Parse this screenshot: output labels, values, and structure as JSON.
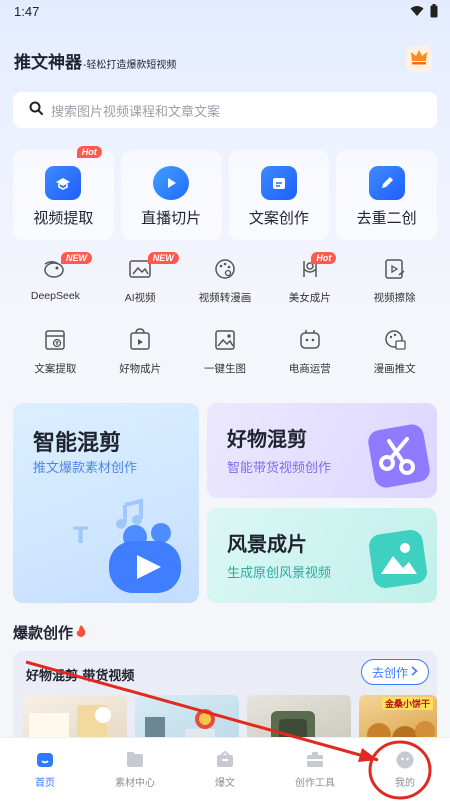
{
  "status": {
    "time": "1:47"
  },
  "header": {
    "title": "推文神器",
    "subtitle": "-轻松打造爆款短视频"
  },
  "search": {
    "placeholder": "搜索图片视频课程和文章文案"
  },
  "main_tools": [
    {
      "label": "视频提取",
      "icon": "video-extract-icon",
      "badge": "Hot"
    },
    {
      "label": "直播切片",
      "icon": "live-clip-icon",
      "badge": ""
    },
    {
      "label": "文案创作",
      "icon": "copywriting-icon",
      "badge": ""
    },
    {
      "label": "去重二创",
      "icon": "dedup-edit-icon",
      "badge": ""
    }
  ],
  "tools_row1": [
    {
      "label": "DeepSeek",
      "icon": "deepseek-icon",
      "badge": "NEW"
    },
    {
      "label": "AI视频",
      "icon": "ai-video-icon",
      "badge": "NEW"
    },
    {
      "label": "视频转漫画",
      "icon": "video-to-comic-icon",
      "badge": ""
    },
    {
      "label": "美女成片",
      "icon": "beauty-video-icon",
      "badge": "Hot"
    },
    {
      "label": "视频擦除",
      "icon": "video-erase-icon",
      "badge": ""
    }
  ],
  "tools_row2": [
    {
      "label": "文案提取",
      "icon": "text-extract-icon"
    },
    {
      "label": "好物成片",
      "icon": "product-video-icon"
    },
    {
      "label": "一键生图",
      "icon": "image-gen-icon"
    },
    {
      "label": "电商运营",
      "icon": "ecommerce-icon"
    },
    {
      "label": "漫画推文",
      "icon": "comic-post-icon"
    }
  ],
  "promos": {
    "smart_mix": {
      "title": "智能混剪",
      "subtitle": "推文爆款素材创作"
    },
    "goods_mix": {
      "title": "好物混剪",
      "subtitle": "智能带货视频创作"
    },
    "scenery": {
      "title": "风景成片",
      "subtitle": "生成原创风景视频"
    }
  },
  "hot_section": {
    "title": "爆款创作",
    "panel_title": "好物混剪-带货视频",
    "create_label": "去创作",
    "thumb_caption": "金桑小饼干"
  },
  "tab_bar": [
    {
      "label": "首页",
      "icon": "home-icon",
      "active": true
    },
    {
      "label": "素材中心",
      "icon": "material-center-icon",
      "active": false
    },
    {
      "label": "爆文",
      "icon": "hot-article-icon",
      "active": false
    },
    {
      "label": "创作工具",
      "icon": "creation-tools-icon",
      "active": false
    },
    {
      "label": "我的",
      "icon": "profile-icon",
      "active": false
    }
  ],
  "colors": {
    "accent": "#2f7bff",
    "hot_badge": "#ff5a4d",
    "annotation": "#e02a20"
  }
}
